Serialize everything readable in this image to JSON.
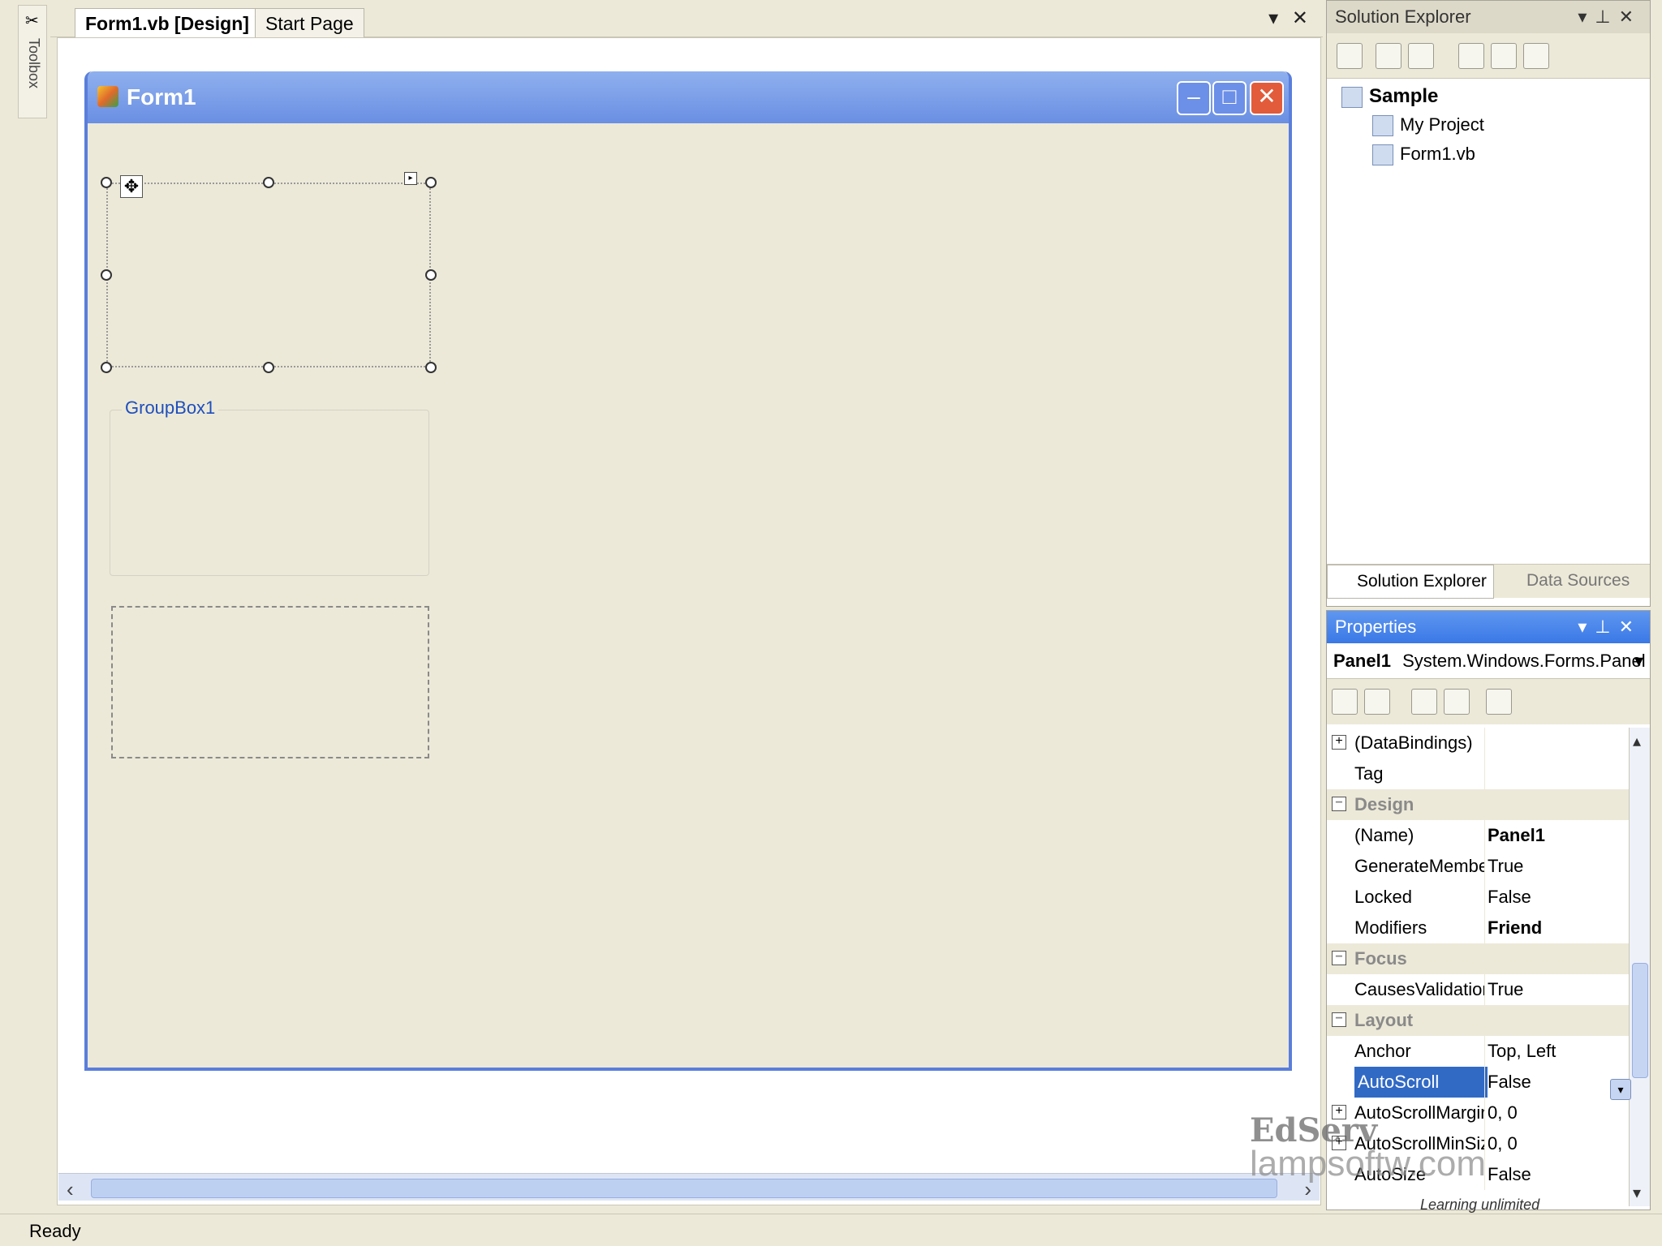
{
  "toolbox": {
    "label": "Toolbox"
  },
  "tabs": [
    {
      "label": "Form1.vb [Design]"
    },
    {
      "label": "Start Page"
    }
  ],
  "form": {
    "title": "Form1",
    "groupbox_label": "GroupBox1"
  },
  "status": {
    "text": "Ready"
  },
  "solution_explorer": {
    "title": "Solution Explorer",
    "tree": {
      "root": "Sample",
      "children": [
        "My Project",
        "Form1.vb"
      ]
    },
    "bottom_tabs": [
      "Solution Explorer",
      "Data Sources"
    ]
  },
  "properties": {
    "title": "Properties",
    "object_name": "Panel1",
    "object_type": "System.Windows.Forms.Panel",
    "rows": [
      {
        "expander": "+",
        "name": "(DataBindings)",
        "value": "",
        "kind": "prop"
      },
      {
        "expander": "",
        "name": "Tag",
        "value": "",
        "kind": "prop"
      },
      {
        "expander": "−",
        "name": "Design",
        "value": "",
        "kind": "cat"
      },
      {
        "expander": "",
        "name": "(Name)",
        "value": "Panel1",
        "kind": "prop",
        "bold": true
      },
      {
        "expander": "",
        "name": "GenerateMember",
        "value": "True",
        "kind": "prop"
      },
      {
        "expander": "",
        "name": "Locked",
        "value": "False",
        "kind": "prop"
      },
      {
        "expander": "",
        "name": "Modifiers",
        "value": "Friend",
        "kind": "prop",
        "bold": true
      },
      {
        "expander": "−",
        "name": "Focus",
        "value": "",
        "kind": "cat"
      },
      {
        "expander": "",
        "name": "CausesValidation",
        "value": "True",
        "kind": "prop"
      },
      {
        "expander": "−",
        "name": "Layout",
        "value": "",
        "kind": "cat"
      },
      {
        "expander": "",
        "name": "Anchor",
        "value": "Top, Left",
        "kind": "prop"
      },
      {
        "expander": "",
        "name": "AutoScroll",
        "value": "False",
        "kind": "prop",
        "selected": true
      },
      {
        "expander": "+",
        "name": "AutoScrollMargin",
        "value": "0, 0",
        "kind": "prop"
      },
      {
        "expander": "+",
        "name": "AutoScrollMinSize",
        "value": "0, 0",
        "kind": "prop"
      },
      {
        "expander": "",
        "name": "AutoSize",
        "value": "False",
        "kind": "prop"
      }
    ]
  },
  "watermark": {
    "line1": "EdServ",
    "line2": "lampsoftw.com",
    "line3": "Learning unlimited"
  },
  "colors": {
    "accent": "#316ac5",
    "form_border": "#5a7edc",
    "groupbox_text": "#1f4fbd"
  }
}
